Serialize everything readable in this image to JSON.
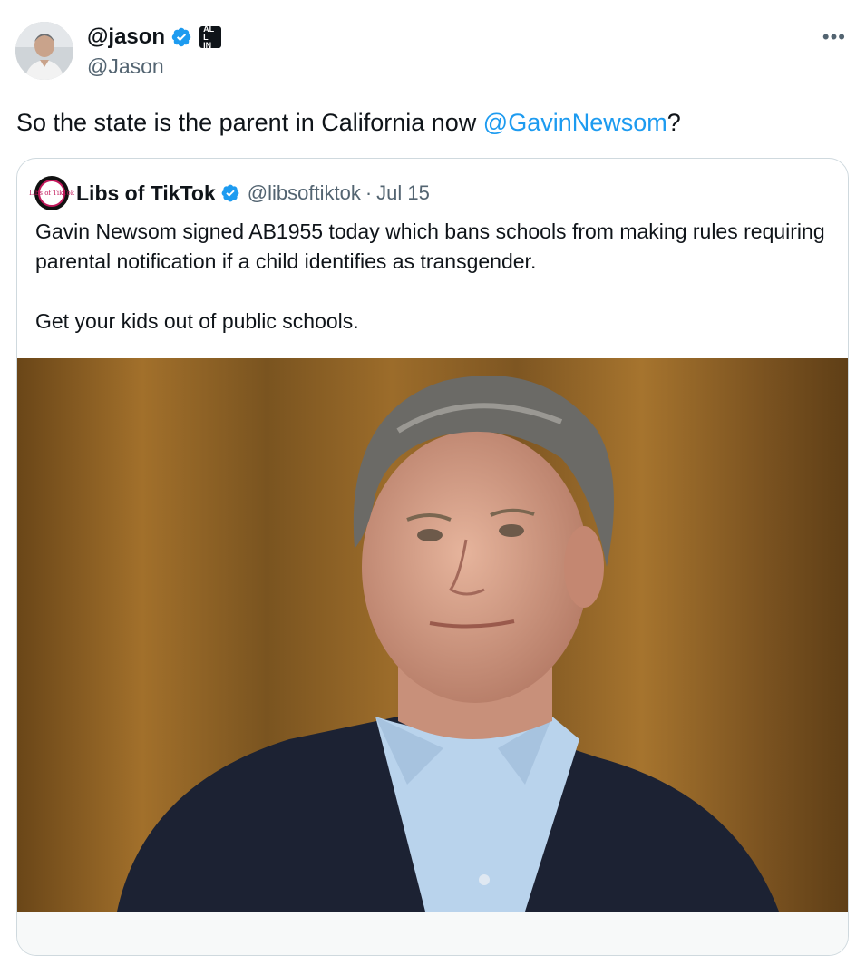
{
  "author": {
    "display_name": "@jason",
    "handle": "@Jason",
    "affiliate_badge_text": "ALL IN"
  },
  "tweet": {
    "text_before": "So the state is the parent in California now ",
    "mention": "@GavinNewsom",
    "text_after": "?"
  },
  "menu": {
    "more_label": "•••"
  },
  "quoted": {
    "avatar_text": "Libs of TikTok",
    "display_name": "Libs of TikTok",
    "handle": "@libsoftiktok",
    "separator": "·",
    "date": "Jul 15",
    "paragraph_1": "Gavin Newsom signed AB1955 today which bans schools from making rules requiring parental notification if a child identifies as transgender.",
    "paragraph_2": "Get your kids out of public schools."
  },
  "colors": {
    "accent": "#1d9bf0",
    "secondary_text": "#536471",
    "border": "#cfd9de"
  },
  "icons": {
    "verified": "verified-badge-icon",
    "more": "more-horizontal-icon"
  }
}
